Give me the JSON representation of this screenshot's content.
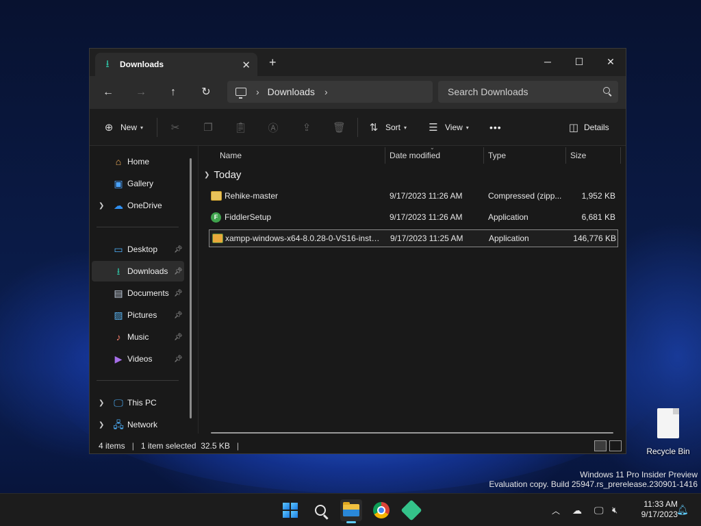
{
  "window": {
    "tab_title": "Downloads",
    "tab_icon": "download-icon",
    "controls": {
      "minimize": "─",
      "maximize": "☐",
      "close": "✕"
    }
  },
  "nav": {
    "address_location": "Downloads",
    "search_placeholder": "Search Downloads"
  },
  "toolbar": {
    "new_label": "New",
    "sort_label": "Sort",
    "view_label": "View",
    "more_label": "•••",
    "details_label": "Details"
  },
  "sidebar": {
    "items": [
      {
        "label": "Home",
        "icon": "home-icon"
      },
      {
        "label": "Gallery",
        "icon": "gallery-icon"
      },
      {
        "label": "OneDrive",
        "icon": "cloud-icon"
      },
      {
        "label": "Desktop",
        "icon": "desktop-icon"
      },
      {
        "label": "Downloads",
        "icon": "download-icon"
      },
      {
        "label": "Documents",
        "icon": "document-icon"
      },
      {
        "label": "Pictures",
        "icon": "pictures-icon"
      },
      {
        "label": "Music",
        "icon": "music-icon"
      },
      {
        "label": "Videos",
        "icon": "videos-icon"
      },
      {
        "label": "This PC",
        "icon": "computer-icon"
      },
      {
        "label": "Network",
        "icon": "network-icon"
      }
    ]
  },
  "filelist": {
    "columns": [
      "Name",
      "Date modified",
      "Type",
      "Size"
    ],
    "group_label": "Today",
    "rows": [
      {
        "name": "Rehike-master",
        "date": "9/17/2023 11:26 AM",
        "type": "Compressed (zipp...",
        "size": "1,952 KB"
      },
      {
        "name": "FiddlerSetup",
        "date": "9/17/2023 11:26 AM",
        "type": "Application",
        "size": "6,681 KB"
      },
      {
        "name": "xampp-windows-x64-8.0.28-0-VS16-insta...",
        "date": "9/17/2023 11:25 AM",
        "type": "Application",
        "size": "146,776 KB"
      }
    ]
  },
  "status": {
    "item_count": "4 items",
    "selection": "1 item selected  32.5 KB"
  },
  "desktop": {
    "recycle_label": "Recycle Bin",
    "watermark_line1": "Windows 11 Pro Insider Preview",
    "watermark_line2": "Evaluation copy. Build 25947.rs_prerelease.230901-1416"
  },
  "taskbar": {
    "time": "11:33 AM",
    "date": "9/17/2023",
    "accent": "#60cdff"
  }
}
